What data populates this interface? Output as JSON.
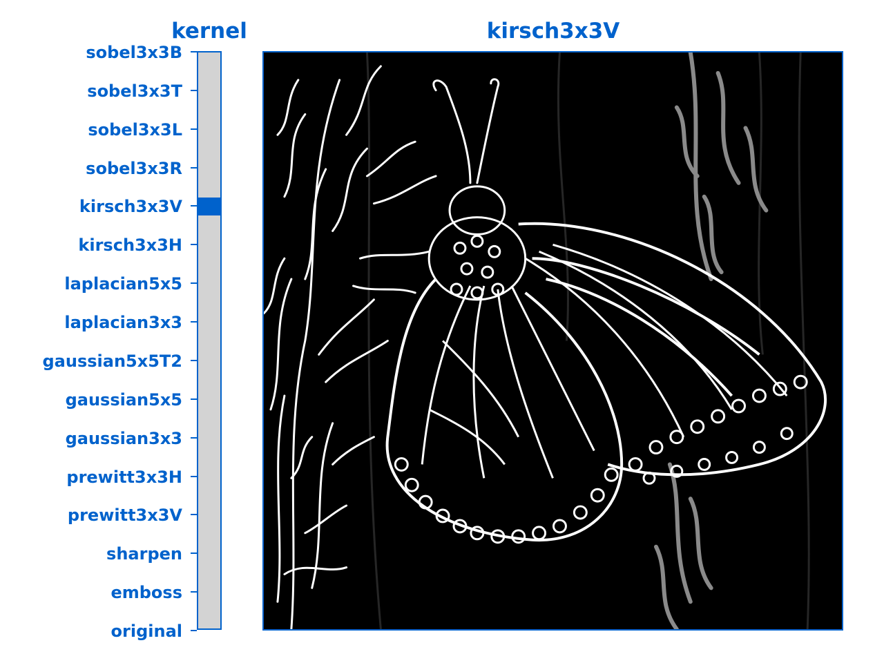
{
  "kernel_panel": {
    "title": "kernel",
    "selected": "kirsch3x3V",
    "options": [
      "sobel3x3B",
      "sobel3x3T",
      "sobel3x3L",
      "sobel3x3R",
      "kirsch3x3V",
      "kirsch3x3H",
      "laplacian5x5",
      "laplacian3x3",
      "gaussian5x5T2",
      "gaussian5x5",
      "gaussian3x3",
      "prewitt3x3H",
      "prewitt3x3V",
      "sharpen",
      "emboss",
      "original"
    ]
  },
  "image_panel": {
    "title": "kirsch3x3V"
  },
  "colors": {
    "accent": "#0062cc",
    "track": "#d3d3d3",
    "image_background": "#000000",
    "edge_lines": "#ffffff"
  },
  "icons": {
    "image": "butterfly-edge-detection-image"
  }
}
